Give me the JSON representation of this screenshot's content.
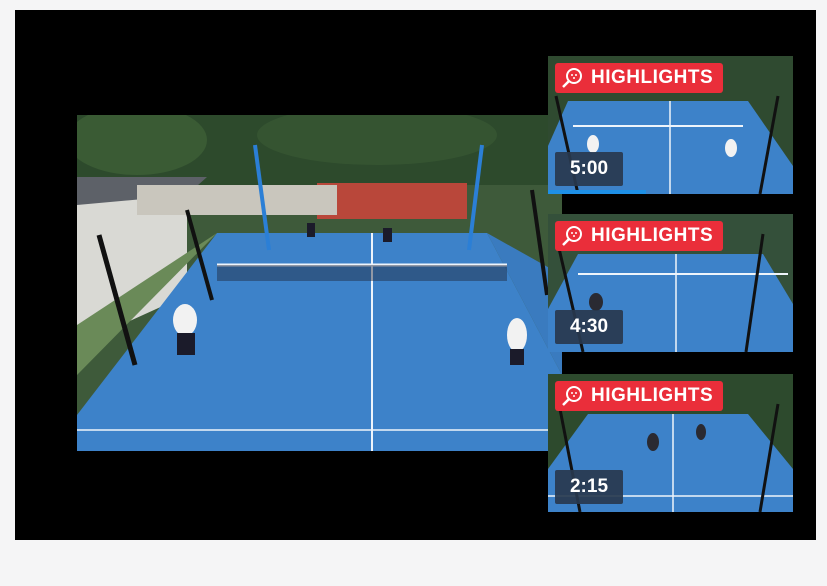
{
  "thumbnails": [
    {
      "badge": "HIGHLIGHTS",
      "duration": "5:00",
      "progress": 0.4
    },
    {
      "badge": "HIGHLIGHTS",
      "duration": "4:30"
    },
    {
      "badge": "HIGHLIGHTS",
      "duration": "2:15"
    }
  ],
  "colors": {
    "badge": "#ea2e3a",
    "court": "#3d82c9",
    "progress": "#1e90e6"
  },
  "icons": {
    "badge_icon": "padel-racket-icon"
  }
}
